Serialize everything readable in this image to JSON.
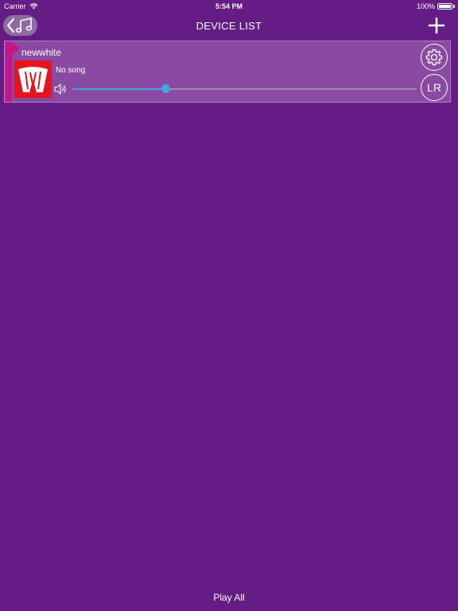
{
  "status_bar": {
    "carrier": "Carrier",
    "time": "5:54 PM",
    "battery": "100%",
    "icons": [
      "wifi-icon",
      "battery-icon"
    ]
  },
  "nav": {
    "title": "DEVICE LIST",
    "back_icon": "chevron-left-music-note-icon",
    "add_icon": "plus-icon"
  },
  "devices": [
    {
      "name": "newwhite",
      "song": "No song",
      "volume": 0.27,
      "settings_icon": "gear-icon",
      "channel_label": "LR",
      "album_art": "w-logo"
    }
  ],
  "footer": {
    "play_all_label": "Play All"
  },
  "colors": {
    "background": "#661c85",
    "card": "#8a4aa4",
    "accent": "#c8138a",
    "slider": "#4aa3df",
    "album_art": "#e8141d"
  }
}
